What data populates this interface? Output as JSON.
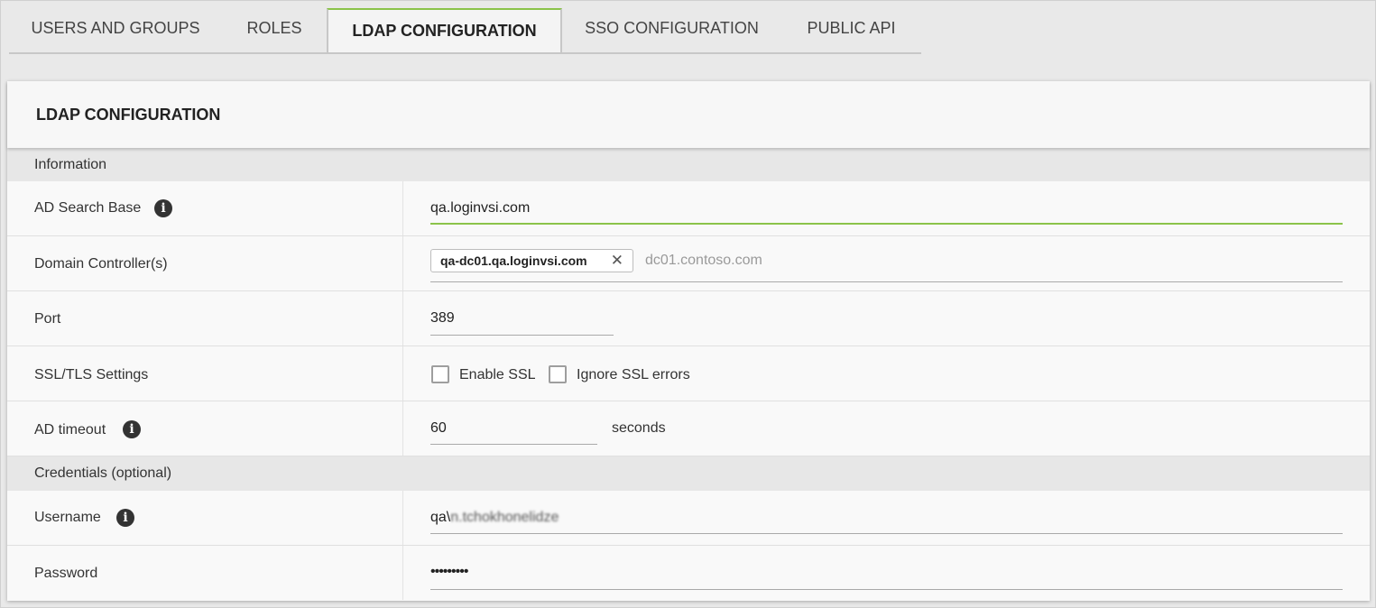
{
  "tabs": [
    {
      "label": "USERS AND GROUPS"
    },
    {
      "label": "ROLES"
    },
    {
      "label": "LDAP CONFIGURATION",
      "active": true
    },
    {
      "label": "SSO CONFIGURATION"
    },
    {
      "label": "PUBLIC API"
    }
  ],
  "card": {
    "title": "LDAP CONFIGURATION"
  },
  "sections": {
    "information": "Information",
    "credentials": "Credentials (optional)"
  },
  "fields": {
    "ad_search_base": {
      "label": "AD Search Base",
      "value": "qa.loginvsi.com",
      "icon": "info-icon"
    },
    "domain_controllers": {
      "label": "Domain Controller(s)",
      "chip": "qa-dc01.qa.loginvsi.com",
      "placeholder": "dc01.contoso.com",
      "chip_close_icon": "close-icon"
    },
    "port": {
      "label": "Port",
      "value": "389"
    },
    "ssl_tls": {
      "label": "SSL/TLS Settings",
      "enable_ssl": "Enable SSL",
      "ignore_ssl_errors": "Ignore SSL errors",
      "enable_ssl_checked": false,
      "ignore_ssl_errors_checked": false
    },
    "ad_timeout": {
      "label": "AD timeout",
      "value": "60",
      "unit": "seconds",
      "icon": "info-icon"
    },
    "username": {
      "label": "Username",
      "value_prefix": "qa\\",
      "value_redacted": "n.tchokhonelidze",
      "icon": "info-icon"
    },
    "password": {
      "label": "Password",
      "value": "•••••••••"
    }
  },
  "colors": {
    "accent": "#8bc34a",
    "background": "#e9e9e9",
    "section": "#e7e7e7"
  }
}
